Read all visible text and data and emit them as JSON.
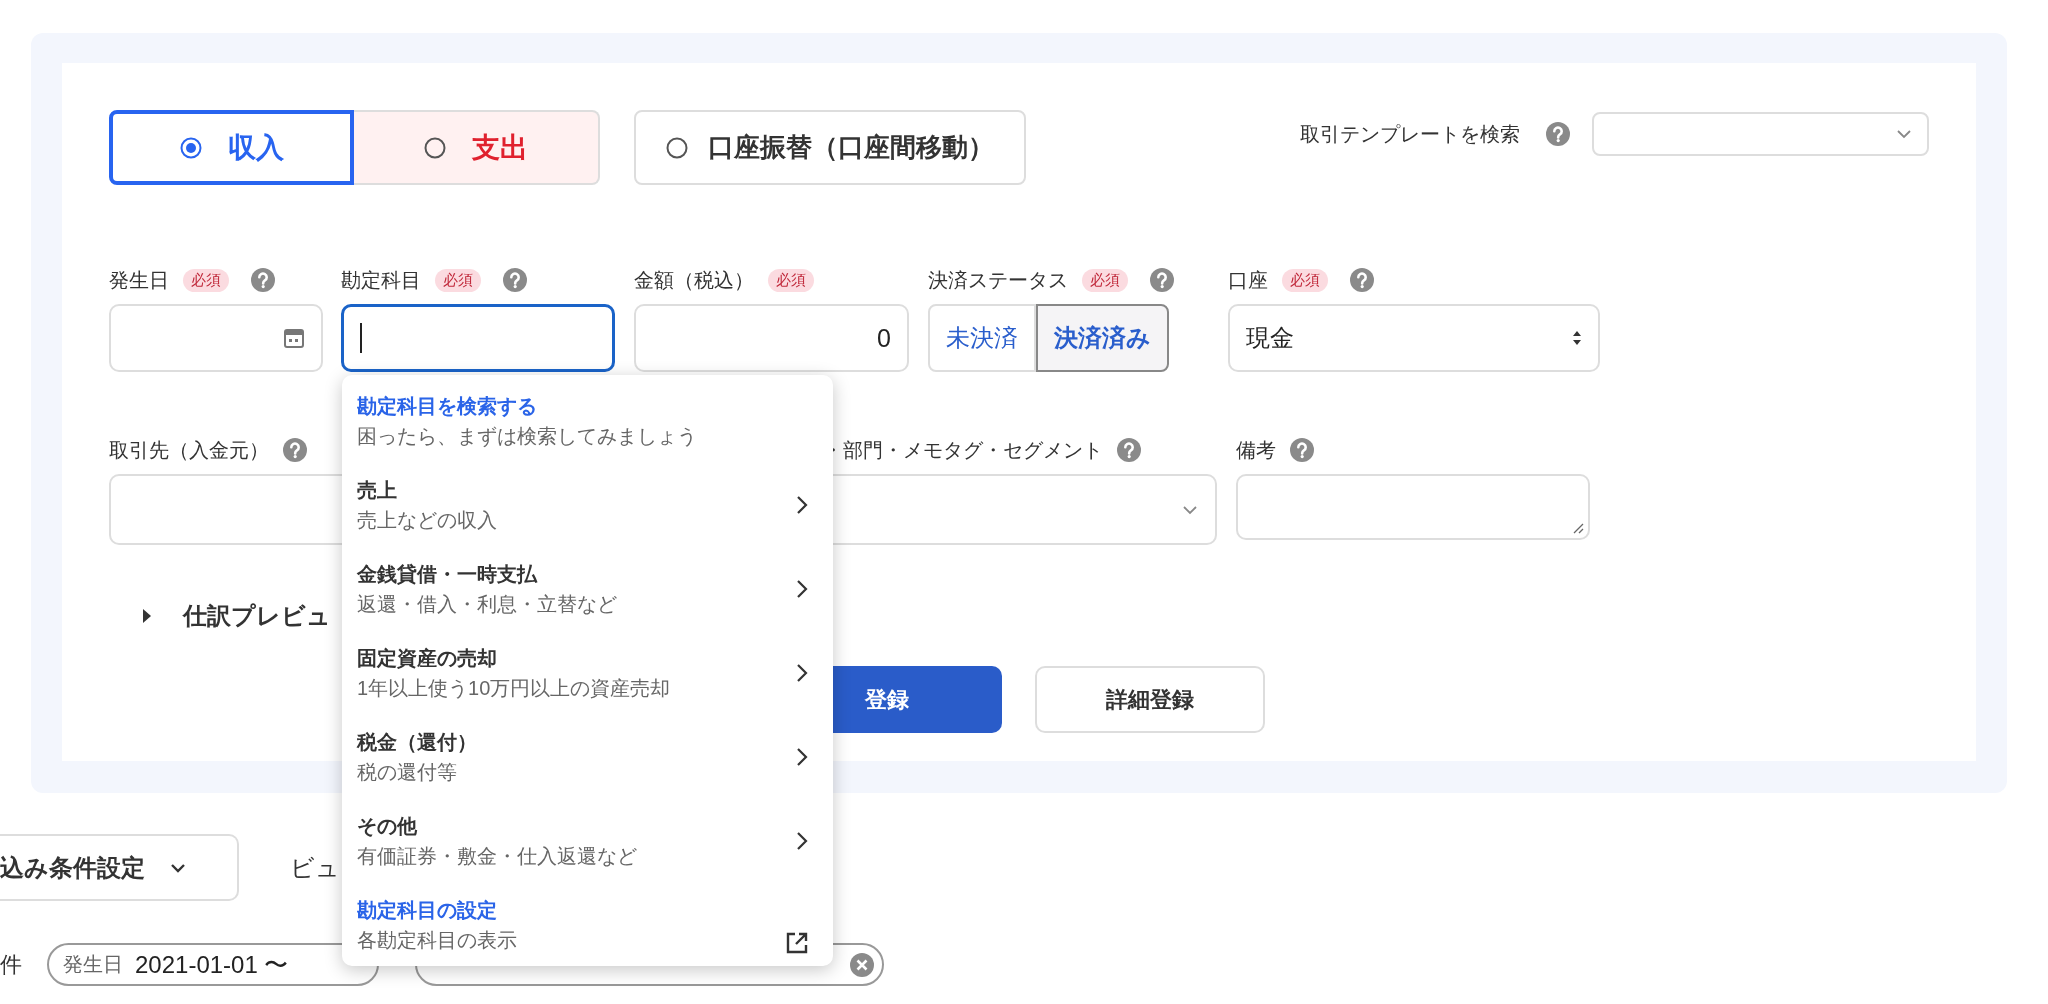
{
  "transaction_type": [
    {
      "label": "収入",
      "kind": "income",
      "selected": true
    },
    {
      "label": "支出",
      "kind": "expense",
      "selected": false
    },
    {
      "label": "口座振替（口座間移動）",
      "kind": "transfer",
      "selected": false
    }
  ],
  "template_search": {
    "label": "取引テンプレートを検索"
  },
  "fields": [
    {
      "label": "発生日",
      "badge": "必須",
      "help": true,
      "kind": "date"
    },
    {
      "label": "勘定科目",
      "badge": "必須",
      "help": true,
      "kind": "text",
      "focused": true
    },
    {
      "label": "金額（税込）",
      "badge": "必須",
      "help": false,
      "kind": "amount",
      "value": "0"
    },
    {
      "label": "決済ステータス",
      "badge": "必須",
      "help": true,
      "kind": "segmented",
      "options": [
        {
          "label": "未決済",
          "selected": false
        },
        {
          "label": "決済済み",
          "selected": true
        }
      ]
    },
    {
      "label": "口座",
      "badge": "必須",
      "help": true,
      "kind": "select",
      "value": "現金"
    }
  ],
  "fields_2": [
    {
      "label": "取引先（入金元）",
      "help": true,
      "kind": "text",
      "focused": false
    },
    {
      "label": "・部門・メモタグ・セグメント",
      "help": true,
      "kind": "combo"
    },
    {
      "label": "備考",
      "help": true,
      "kind": "textarea"
    }
  ],
  "preview_toggle": {
    "label": "仕訳プレビュ",
    "expanded": false
  },
  "actions": [
    {
      "label": "登録",
      "kind": "primary"
    },
    {
      "label": "詳細登録",
      "kind": "secondary"
    }
  ],
  "account_menu": {
    "items": [
      {
        "title": "勘定科目を検索する",
        "subtitle": "困ったら、まずは検索してみましょう",
        "kind": "link"
      },
      {
        "title": "売上",
        "subtitle": "売上などの収入",
        "kind": "category"
      },
      {
        "title": "金銭貸借・一時支払",
        "subtitle": "返還・借入・利息・立替など",
        "kind": "category"
      },
      {
        "title": "固定資産の売却",
        "subtitle": "1年以上使う10万円以上の資産売却",
        "kind": "category"
      },
      {
        "title": "税金（還付）",
        "subtitle": "税の還付等",
        "kind": "category"
      },
      {
        "title": "その他",
        "subtitle": "有価証券・敷金・仕入返還など",
        "kind": "category"
      },
      {
        "title": "勘定科目の設定",
        "subtitle": "各勘定科目の表示",
        "kind": "external"
      }
    ]
  },
  "filter_bar": {
    "button": "込み条件設定",
    "view_label": "ビュ",
    "conditions_label": "件",
    "chips": [
      {
        "label": "発生日",
        "value": "2021-01-01 〜",
        "removable": false
      },
      {
        "removable": true
      }
    ]
  }
}
